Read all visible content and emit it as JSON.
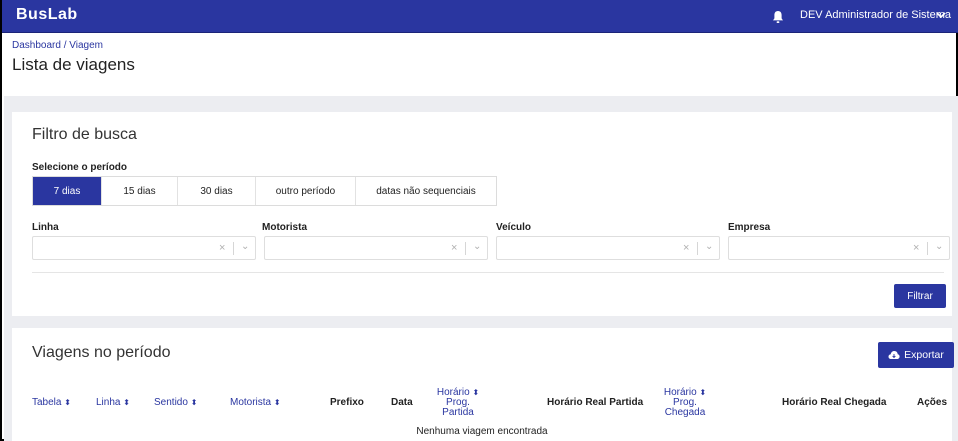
{
  "app": {
    "brand": "BusLab",
    "user_name": "DEV Administrador de Sistema",
    "bell_icon": "bell-icon",
    "chevron_icon": "chevron-down-icon",
    "accent_color": "#2a36a0"
  },
  "header": {
    "breadcrumb": "Dashboard / Viagem",
    "title": "Lista de viagens"
  },
  "filter": {
    "title": "Filtro de busca",
    "period_label": "Selecione o período",
    "period_options": [
      "7 dias",
      "15 dias",
      "30 dias",
      "outro período",
      "datas não sequenciais"
    ],
    "period_selected": "7 dias",
    "fields": [
      {
        "label": "Linha",
        "value": ""
      },
      {
        "label": "Motorista",
        "value": ""
      },
      {
        "label": "Veículo",
        "value": ""
      },
      {
        "label": "Empresa",
        "value": ""
      }
    ],
    "clear_glyph": "×",
    "dropdown_glyph": "⌄",
    "button": "Filtrar"
  },
  "trips": {
    "title": "Viagens no período",
    "export_button": "Exportar",
    "export_icon": "cloud-download-icon",
    "sort_glyph": "⬍",
    "columns": [
      {
        "lines": [
          "Tabela"
        ],
        "sortable": true
      },
      {
        "lines": [
          "Linha"
        ],
        "sortable": true
      },
      {
        "lines": [
          "Sentido"
        ],
        "sortable": true
      },
      {
        "lines": [
          "Motorista"
        ],
        "sortable": true
      },
      {
        "lines": [
          "Prefixo"
        ],
        "sortable": false
      },
      {
        "lines": [
          "Data"
        ],
        "sortable": false
      },
      {
        "lines": [
          "Horário",
          "Prog.",
          "Partida"
        ],
        "sortable": true
      },
      {
        "lines": [
          "Horário Real Partida"
        ],
        "sortable": false
      },
      {
        "lines": [
          "Horário",
          "Prog.",
          "Chegada"
        ],
        "sortable": true
      },
      {
        "lines": [
          "Horário Real Chegada"
        ],
        "sortable": false
      },
      {
        "lines": [
          "Ações"
        ],
        "sortable": false
      }
    ],
    "empty_message": "Nenhuma viagem encontrada"
  }
}
